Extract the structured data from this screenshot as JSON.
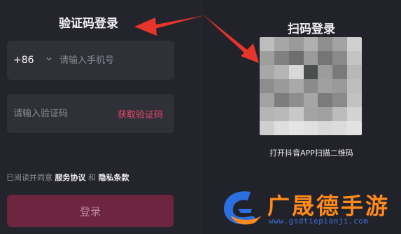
{
  "sms_login": {
    "title": "验证码登录",
    "country_code": "+86",
    "phone_placeholder": "请输入手机号",
    "code_placeholder": "请输入验证码",
    "get_code_label": "获取验证码",
    "agreement": {
      "prefix": "已阅读并同意",
      "terms": "服务协议",
      "and": "和",
      "privacy": "隐私条款"
    },
    "login_button": "登录"
  },
  "qr_login": {
    "title": "扫码登录",
    "caption": "打开抖音APP扫描二维码"
  },
  "watermark": {
    "text": "广晟德手游",
    "url": "www.gsdtiepianji.com"
  },
  "colors": {
    "accent": "#e54a6d",
    "button_bg": "#6e2540",
    "arrow": "#e8352b",
    "watermark_text": "#ff8a1c",
    "watermark_url": "#3c73d8"
  }
}
